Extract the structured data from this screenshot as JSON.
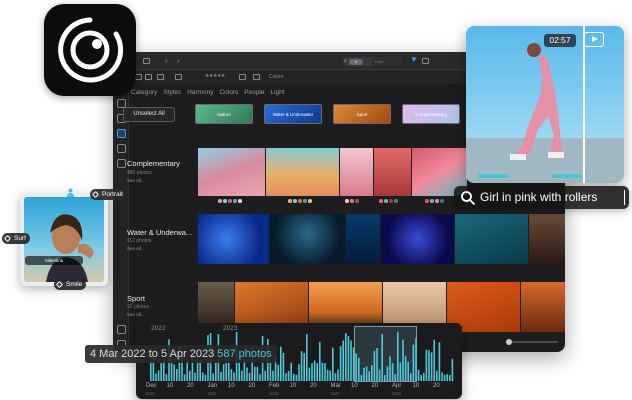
{
  "app_icon": {
    "name": "camera-aperture-icon"
  },
  "toolbar": {
    "search_tag": "h",
    "filter_placeholder": "Filter",
    "rating": "★★★★★",
    "colors_label": "Colors"
  },
  "tabs": [
    "Category",
    "Styles",
    "Harmony",
    "Colors",
    "People",
    "Light"
  ],
  "unselect_label": "Unselect All",
  "chips": [
    {
      "label": "Nature",
      "color": "#3a8a6a"
    },
    {
      "label": "Water & Underwater",
      "color": "#1e4fb4"
    },
    {
      "label": "Sport",
      "color": "#c8641e"
    },
    {
      "label": "Complementary",
      "color": "#c8a0d2"
    }
  ],
  "categories": [
    {
      "title": "Complementary",
      "count": "485 photos",
      "see_all": "See All..."
    },
    {
      "title": "Water & Underwa...",
      "count": "112 photos",
      "see_all": "See All..."
    },
    {
      "title": "Sport",
      "count": "32 photos",
      "see_all": "See All..."
    }
  ],
  "video": {
    "time": "02:57"
  },
  "ai_search": {
    "query": "Girl in pink with rollers"
  },
  "face_card": {
    "name": "Valentina",
    "tags": {
      "portrait": "Portrait",
      "surf": "Surf",
      "smile": "Smile"
    }
  },
  "timeline": {
    "range_from": "4 Mar 2022",
    "range_to_word": "to",
    "range_to": "5 Apr 2023",
    "count": "587 photos",
    "years": [
      "2022",
      "2023"
    ],
    "ticks": [
      "Dec",
      "10",
      "20",
      "Jan",
      "10",
      "20",
      "Feb",
      "10",
      "20",
      "Mar",
      "10",
      "20",
      "Apr",
      "10",
      "20"
    ],
    "tick_years": [
      "2022",
      "2023",
      "2023",
      "2023",
      "2023"
    ]
  },
  "colors": {
    "accent": "#4ec9d9",
    "window_bg": "#1d1d1f",
    "selection": "#3aa0ff"
  }
}
